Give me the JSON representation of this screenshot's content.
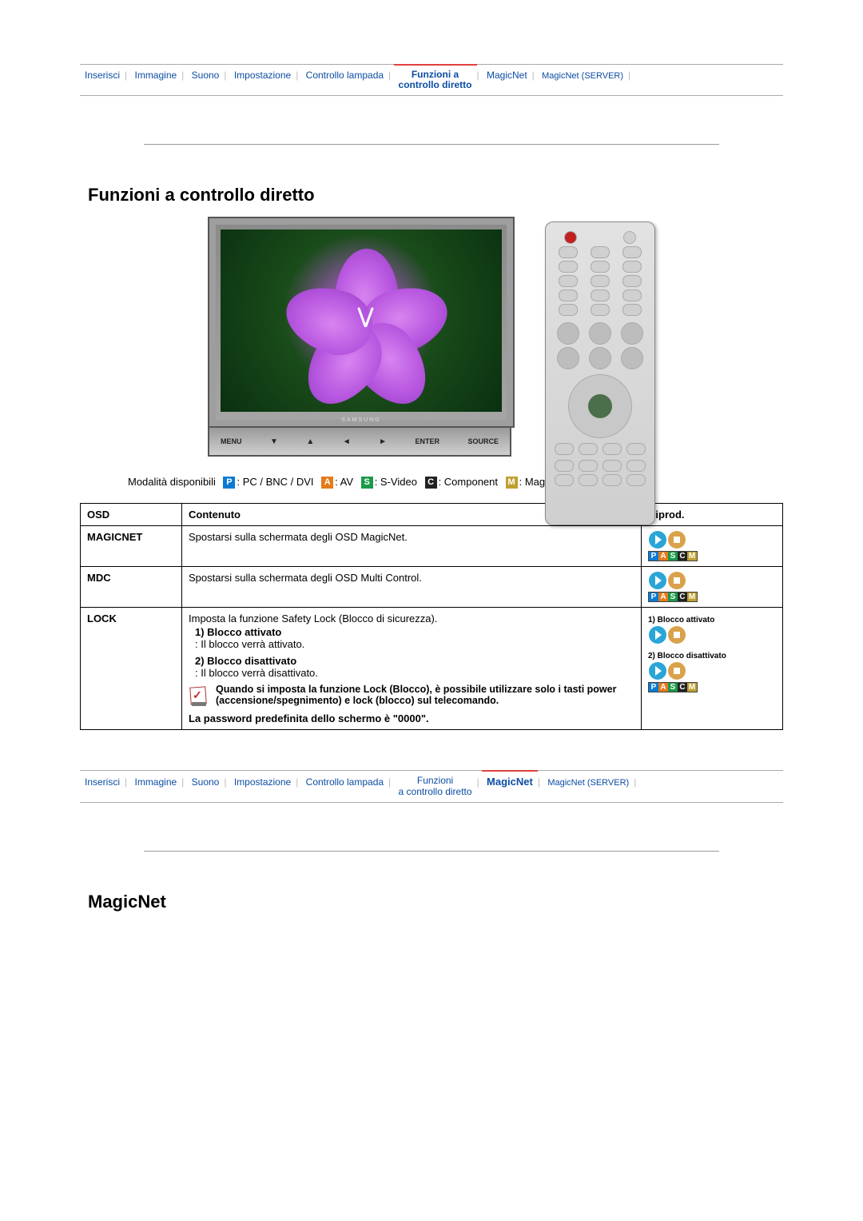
{
  "nav_top": {
    "items": [
      {
        "label": "Inserisci"
      },
      {
        "label": "Immagine"
      },
      {
        "label": "Suono"
      },
      {
        "label": "Impostazione"
      },
      {
        "label": "Controllo lampada"
      }
    ],
    "active_line1": "Funzioni a",
    "active_line2": "controllo diretto",
    "after": [
      {
        "label": "MagicNet"
      },
      {
        "label": "MagicNet (SERVER)"
      }
    ]
  },
  "section1_title": "Funzioni a controllo diretto",
  "button_bar": {
    "menu": "MENU",
    "enter": "ENTER",
    "source": "SOURCE"
  },
  "tv_logo": "SAMSUNG",
  "legend": {
    "label": "Modalità disponibili",
    "modes": [
      {
        "code": "P",
        "text": ": PC / BNC / DVI"
      },
      {
        "code": "A",
        "text": ": AV"
      },
      {
        "code": "S",
        "text": ": S-Video"
      },
      {
        "code": "C",
        "text": ": Component"
      },
      {
        "code": "M",
        "text": ": MagicNet"
      }
    ]
  },
  "table": {
    "head": {
      "c1": "OSD",
      "c2": "Contenuto",
      "c3": "Riprod."
    },
    "rows": [
      {
        "osd": "MAGICNET",
        "content": "Spostarsi sulla schermata degli OSD MagicNet."
      },
      {
        "osd": "MDC",
        "content": "Spostarsi sulla schermata degli OSD Multi Control."
      }
    ],
    "lock": {
      "osd": "LOCK",
      "intro": "Imposta la funzione Safety Lock (Blocco di sicurezza).",
      "opt1_title": "1) Blocco attivato",
      "opt1_desc": ": Il blocco verrà attivato.",
      "opt2_title": "2) Blocco disattivato",
      "opt2_desc": ": Il blocco verrà disattivato.",
      "note": "Quando si imposta la funzione Lock (Blocco), è possibile utilizzare solo i tasti power (accensione/spegnimento) e lock (blocco) sul telecomando.",
      "password": "La password predefinita dello schermo è \"0000\".",
      "riprod_opt1": "1) Blocco attivato",
      "riprod_opt2": "2) Blocco disattivato"
    }
  },
  "nav_bottom": {
    "items": [
      {
        "label": "Inserisci"
      },
      {
        "label": "Immagine"
      },
      {
        "label": "Suono"
      },
      {
        "label": "Impostazione"
      },
      {
        "label": "Controllo lampada"
      }
    ],
    "mid_line1": "Funzioni",
    "mid_line2": "a controllo diretto",
    "active": "MagicNet",
    "after": [
      {
        "label": "MagicNet (SERVER)"
      }
    ]
  },
  "section2_title": "MagicNet"
}
